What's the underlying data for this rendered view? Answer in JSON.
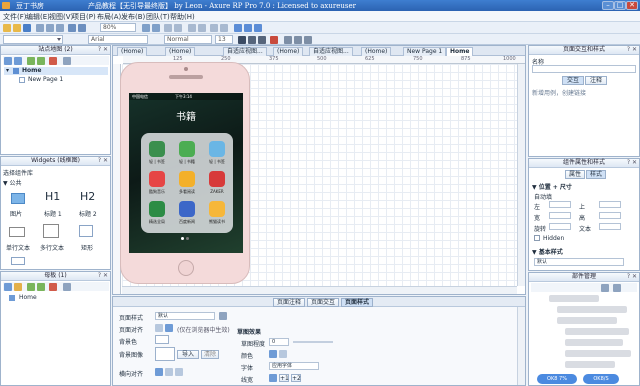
{
  "window": {
    "app_name": "豆丁书房",
    "title": "产品教程【无引导最终版】 by Leon - Axure RP Pro 7.0 : Licensed to axureuser",
    "min": "–",
    "max": "□",
    "close": "✕"
  },
  "menu": [
    "文件(F)",
    "编辑(E)",
    "视图(V)",
    "项目(P)",
    "布局(A)",
    "发布(B)",
    "团队(T)",
    "帮助(H)"
  ],
  "toolbar": {
    "zoom": "80%",
    "font": "Arial",
    "style": "Normal",
    "size": "13"
  },
  "tabs": [
    {
      "label": "(Home)"
    },
    {
      "label": "(Home)"
    },
    {
      "label": "自适应视图..."
    },
    {
      "label": "(Home)"
    },
    {
      "label": "自适应视图..."
    },
    {
      "label": "(Home)"
    },
    {
      "label": "New Page 1"
    },
    {
      "label": "Home"
    }
  ],
  "ruler_h": [
    "125",
    "250",
    "375",
    "500",
    "625",
    "750",
    "875",
    "1000"
  ],
  "sitemap": {
    "title": "站点地图 (2)",
    "root": "Home",
    "child": "New Page 1"
  },
  "widgets": {
    "title": "Widgets (线框图)",
    "library": "选择组件库",
    "category": "▼ 公共",
    "items": [
      {
        "label": "图片",
        "glyph": ""
      },
      {
        "label": "标题 1",
        "glyph": "H1"
      },
      {
        "label": "标题 2",
        "glyph": "H2"
      },
      {
        "label": "单行文本",
        "glyph": ""
      },
      {
        "label": "多行文本",
        "glyph": ""
      },
      {
        "label": "矩形",
        "glyph": ""
      }
    ]
  },
  "masters": {
    "title": "母板 (1)",
    "item": "Home"
  },
  "phone": {
    "carrier": "中国电信",
    "time": "下午3:14",
    "folder_title": "书籍",
    "apps": [
      {
        "label": "轻 | 书签",
        "color": "#3a8f4d"
      },
      {
        "label": "轻 | 书籍",
        "color": "#4cad52"
      },
      {
        "label": "轻 | 书签",
        "color": "#6ab6e5"
      },
      {
        "label": "酷狗音乐",
        "color": "#e64545"
      },
      {
        "label": "多看阅读",
        "color": "#f3b02a"
      },
      {
        "label": "ZAKER",
        "color": "#d73a3a"
      },
      {
        "label": "精选全局",
        "color": "#2c8c45"
      },
      {
        "label": "百度新闻",
        "color": "#3c67c8"
      },
      {
        "label": "熊猫读书",
        "color": "#f6b739"
      }
    ]
  },
  "interactions": {
    "title": "页面交互和样式",
    "name_label": "名称",
    "tab1": "交互",
    "tab2": "注释",
    "hint": "新增用例，创建链接"
  },
  "props": {
    "title": "组件属性和样式",
    "tab1": "属性",
    "tab2": "样式",
    "section1": "▼ 位置 + 尺寸",
    "sub": "自动填",
    "left": "左",
    "top": "上",
    "width": "宽",
    "height": "高",
    "rotate": "旋转",
    "text": "文本",
    "hidden": "Hidden",
    "section2": "▼ 基本样式",
    "default": "默认"
  },
  "widget_manager": {
    "title": "部件管理"
  },
  "bottom": {
    "tabs": [
      "页面注释",
      "页面交互",
      "页面样式"
    ],
    "active": "页面样式",
    "page_style_label": "页面样式",
    "page_style_value": "默认",
    "align_label": "页面对齐",
    "align_hint": "(仅在浏览器中生效)",
    "bg_color": "背景色",
    "bg_image": "背景图像",
    "import": "导入",
    "clear": "清除",
    "h_align": "横向对齐",
    "sketch_title": "草图效果",
    "sketch_level": "草图程度",
    "sketch_value": "0",
    "color": "颜色",
    "font": "字体",
    "font_value": "应用字体",
    "line": "线宽",
    "line_add": "+1",
    "line_add2": "+2"
  },
  "status": {
    "btn1": "OK8 7%",
    "btn2": "OK8/S"
  }
}
